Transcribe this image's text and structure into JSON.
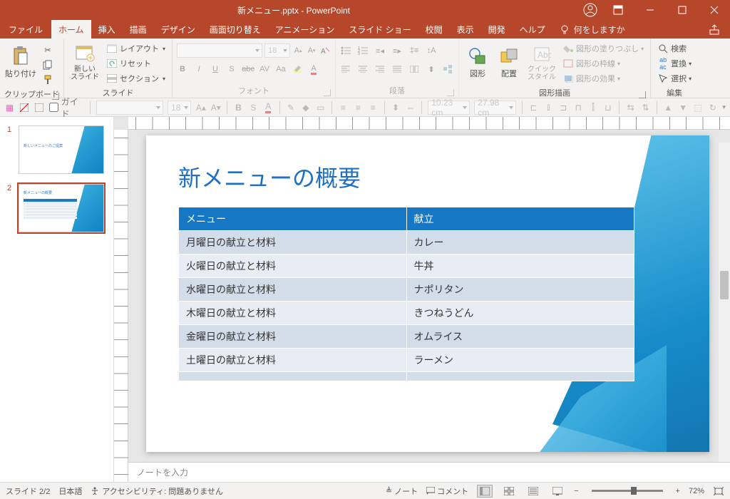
{
  "titlebar": {
    "title": "新メニュー.pptx - PowerPoint"
  },
  "tabs": {
    "file": "ファイル",
    "home": "ホーム",
    "insert": "挿入",
    "draw": "描画",
    "design": "デザイン",
    "transition": "画面切り替え",
    "animation": "アニメーション",
    "slideshow": "スライド ショー",
    "review": "校閲",
    "view": "表示",
    "developer": "開発",
    "help": "ヘルプ",
    "tell": "何をしますか"
  },
  "ribbon": {
    "clipboard": {
      "label": "クリップボード",
      "paste": "貼り付け"
    },
    "slides": {
      "label": "スライド",
      "new": "新しい\nスライド",
      "layout": "レイアウト",
      "reset": "リセット",
      "section": "セクション"
    },
    "font": {
      "label": "フォント",
      "size": "18"
    },
    "paragraph": {
      "label": "段落"
    },
    "drawing": {
      "label": "図形描画",
      "shapes": "図形",
      "arrange": "配置",
      "quick": "クイック\nスタイル",
      "fill": "図形の塗りつぶし",
      "outline": "図形の枠線",
      "effects": "図形の効果"
    },
    "editing": {
      "label": "編集",
      "find": "検索",
      "replace": "置換",
      "select": "選択"
    }
  },
  "qat2": {
    "guide": "ガイド",
    "fontsize": "18",
    "w": "10.23 cm",
    "h": "27.98 cm"
  },
  "thumbs": {
    "s1": {
      "num": "1",
      "title": "新しいメニューのご提案"
    },
    "s2": {
      "num": "2",
      "title": "新メニューの概要"
    }
  },
  "slide": {
    "title": "新メニューの概要",
    "headers": [
      "メニュー",
      "献立"
    ],
    "rows": [
      [
        "月曜日の献立と材料",
        "カレー"
      ],
      [
        "火曜日の献立と材料",
        "牛丼"
      ],
      [
        "水曜日の献立と材料",
        "ナポリタン"
      ],
      [
        "木曜日の献立と材料",
        "きつねうどん"
      ],
      [
        "金曜日の献立と材料",
        "オムライス"
      ],
      [
        "土曜日の献立と材料",
        "ラーメン"
      ],
      [
        "",
        ""
      ]
    ]
  },
  "notes": {
    "placeholder": "ノートを入力"
  },
  "status": {
    "slide": "スライド 2/2",
    "lang": "日本語",
    "a11y": "アクセシビリティ: 問題ありません",
    "notes": "ノート",
    "comments": "コメント",
    "zoom": "72%"
  }
}
